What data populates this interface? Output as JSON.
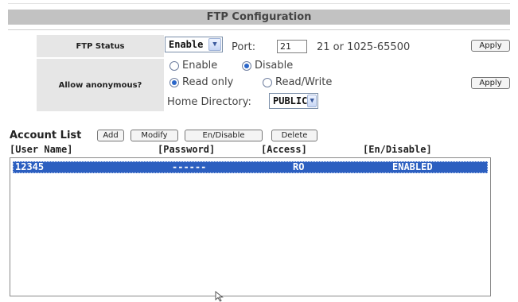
{
  "header": {
    "title": "FTP Configuration"
  },
  "ftp_status": {
    "label": "FTP Status",
    "selected": "Enable",
    "port_label": "Port:",
    "port_value": "21",
    "port_hint": "21 or 1025-65500",
    "apply_label": "Apply"
  },
  "anonymous": {
    "label": "Allow anonymous?",
    "enable_label": "Enable",
    "disable_label": "Disable",
    "read_only_label": "Read only",
    "read_write_label": "Read/Write",
    "home_dir_label": "Home Directory:",
    "home_dir_selected": "PUBLIC",
    "apply_label": "Apply"
  },
  "account_list": {
    "title": "Account List",
    "buttons": {
      "add": "Add",
      "modify": "Modify",
      "en_disable": "En/Disable",
      "delete": "Delete"
    },
    "columns": {
      "user": "[User Name]",
      "password": "[Password]",
      "access": "[Access]",
      "state": "[En/Disable]"
    },
    "rows": [
      {
        "user": "12345",
        "password": "------",
        "access": "RO",
        "state": "ENABLED"
      }
    ]
  },
  "colors": {
    "selection": "#2c5fc0",
    "title_bar": "#c2c2c2",
    "label_bg": "#e6e6e6"
  }
}
